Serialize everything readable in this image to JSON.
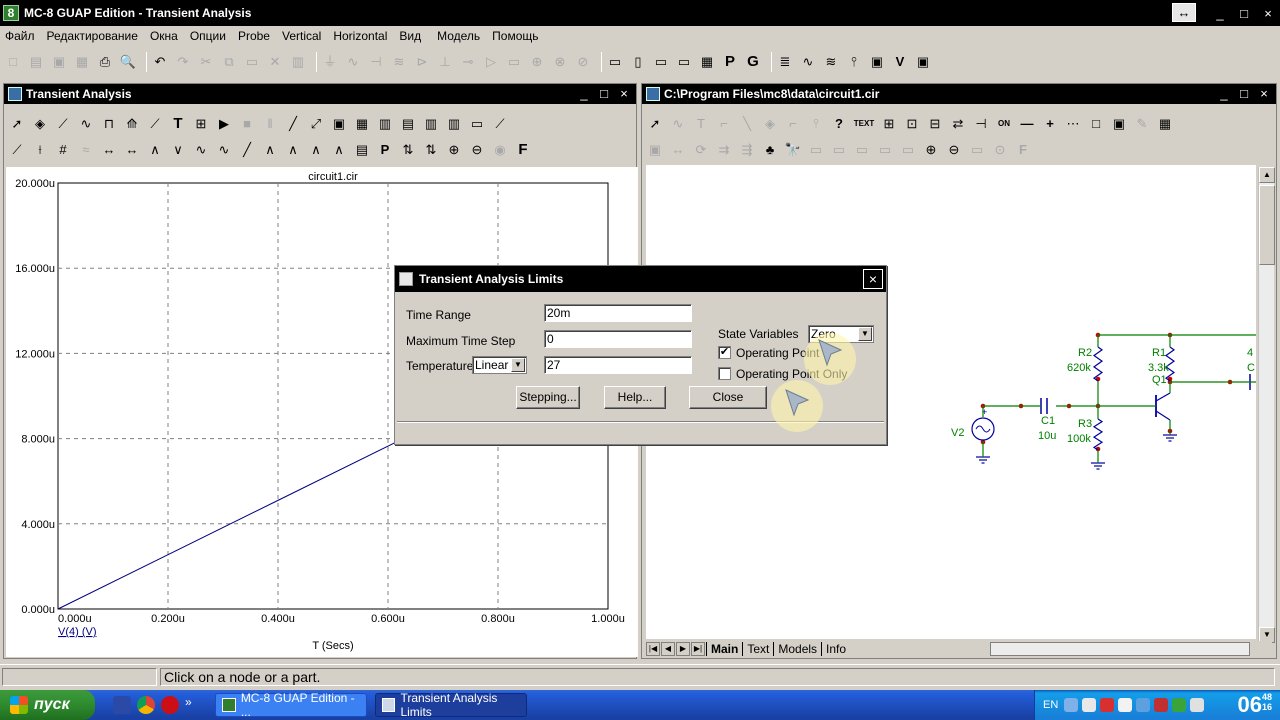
{
  "app": {
    "title": "MC-8 GUAP Edition - Transient Analysis",
    "icon_char": "8",
    "min": "_",
    "max": "□",
    "close": "×",
    "resize": "↔"
  },
  "menu": [
    "Файл",
    "Редактирование",
    "Окна",
    "Опции",
    "Probe",
    "Vertical",
    "Horizontal",
    "Вид",
    "Модель",
    "Помощь"
  ],
  "toolbar_glyphs": {
    "main_left": [
      "□",
      "▤",
      "▣",
      "▦",
      "⎙",
      "🔍",
      "↶",
      "↷",
      "✂",
      "⧉",
      "▭",
      "✕",
      "▥"
    ],
    "main_mid": [
      "⏚",
      "∿",
      "⊣",
      "≋",
      "⊳",
      "⊥",
      "⊸",
      "▷",
      "▭",
      "⊕",
      "⊗",
      "⊘"
    ],
    "main_right": [
      "▭",
      "▯",
      "▭",
      "▭",
      "▦",
      "P",
      "G",
      "≣",
      "∿",
      "≋",
      "⫯",
      "▣",
      "V",
      "▣"
    ],
    "ta_row1": [
      "➚",
      "◈",
      "⟋",
      "∿",
      "⊓",
      "⟰",
      "⟋",
      "T",
      "⊞",
      "▶",
      "■",
      "‖",
      "╱",
      "⤢",
      "▣",
      "▦",
      "▥",
      "▤",
      "▥",
      "▥",
      "▭",
      "⟋"
    ],
    "ta_row2": [
      "⟋",
      "⟊",
      "#",
      "≈",
      "↔",
      "↔",
      "∧",
      "∨",
      "∿",
      "∿",
      "╱",
      "∧",
      "∧",
      "∧",
      "∧",
      "▤",
      "P",
      "⇅",
      "⇅",
      "⊕",
      "⊖",
      "◉",
      "F"
    ],
    "sch_row1": [
      "➚",
      "∿",
      "T",
      "⌐",
      "╲",
      "◈",
      "⌐",
      "⫯",
      "?",
      "TEXT",
      "⊞",
      "⊡",
      "⊟",
      "⇄",
      "⊣",
      "ON",
      "—",
      "+",
      "⋯",
      "□",
      "▣",
      "✎",
      "▦"
    ],
    "sch_row2": [
      "▣",
      "↔",
      "⟳",
      "⇉",
      "⇶",
      "♣",
      "🔭",
      "▭",
      "▭",
      "▭",
      "▭",
      "▭",
      "⊕",
      "⊖",
      "▭",
      "⊙",
      "F"
    ]
  },
  "transient_window": {
    "title": "Transient Analysis",
    "min": "_",
    "max": "□",
    "close": "×"
  },
  "schematic_window": {
    "title": "C:\\Program Files\\mc8\\data\\circuit1.cir",
    "min": "_",
    "max": "□",
    "close": "×",
    "tabs": [
      "Main",
      "Text",
      "Models",
      "Info"
    ],
    "scroll_up": "▲",
    "scroll_down": "▼",
    "nav": [
      "|◀",
      "◀",
      "▶",
      "▶|"
    ]
  },
  "schematic": {
    "labels": {
      "r2": "R2",
      "r2_value": "620k",
      "r1": "R1",
      "r1_value": "3.3k",
      "q1": "Q1",
      "c1": "C1",
      "c1_value": "10u",
      "r3": "R3",
      "r3_value": "100k",
      "v2": "V2",
      "plus": "+",
      "cut_label_1": "4",
      "cut_label_2": "C"
    },
    "wire_color": "#008000",
    "node_color": "#cc0000",
    "part_color": "#0000a0"
  },
  "chart_data": {
    "type": "line",
    "title": "circuit1.cir",
    "xlabel": "T (Secs)",
    "ylabel": "V(4) (V)",
    "xlim": [
      0,
      1.0
    ],
    "ylim": [
      0,
      20.0
    ],
    "x_ticks": [
      0,
      0.2,
      0.4,
      0.6,
      0.8,
      1.0
    ],
    "x_tick_labels": [
      "0.000u",
      "0.200u",
      "0.400u",
      "0.600u",
      "0.800u",
      "1.000u"
    ],
    "y_ticks": [
      0,
      4,
      8,
      12,
      16,
      20
    ],
    "y_tick_labels": [
      "0.000u",
      "4.000u",
      "8.000u",
      "12.000u",
      "16.000u",
      "20.000u"
    ],
    "grid": true,
    "line_color": "#000080",
    "series": [
      {
        "name": "V(4) (V)",
        "x": [
          0,
          0.2,
          0.4,
          0.62
        ],
        "y": [
          0,
          2.55,
          5.1,
          7.9
        ]
      }
    ]
  },
  "dialog": {
    "title": "Transient Analysis Limits",
    "close": "×",
    "time_range_label": "Time Range",
    "time_range_value": "20m",
    "max_step_label": "Maximum Time Step",
    "max_step_value": "0",
    "temperature_label": "Temperature",
    "temperature_mode": "Linear",
    "temperature_value": "27",
    "state_variables_label": "State Variables",
    "state_variables_value": "Zero",
    "operating_point_label": "Operating Point",
    "operating_point_checked": "✔",
    "operating_point_only_label": "Operating Point Only",
    "operating_point_only_checked": "",
    "stepping_button": "Stepping...",
    "help_button": "Help...",
    "close_button": "Close",
    "dropdown_arrow": "▼"
  },
  "status": {
    "message": "Click on a node or a part."
  },
  "taskbar": {
    "start": "пуск",
    "more": "»",
    "tasks": [
      "MC-8 GUAP Edition - ...",
      "Transient Analysis Limits"
    ],
    "lang": "EN",
    "clock_hm": "06",
    "clock_min": "48",
    "clock_sec": "16"
  },
  "colors": {
    "titlebar": "#000000",
    "plot_line": "#000080",
    "taskbar": "#245edb",
    "start_green": "#2f8a2f"
  }
}
